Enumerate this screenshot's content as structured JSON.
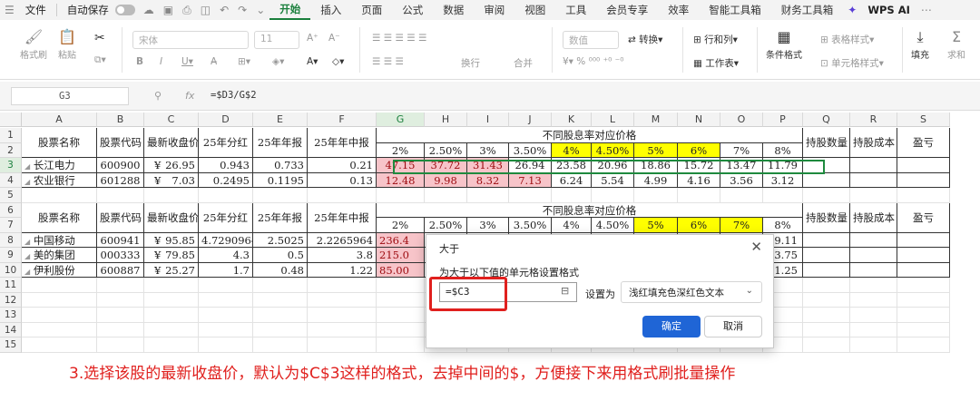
{
  "menubar": {
    "file": "文件",
    "autosave": "自动保存",
    "tabs": [
      "开始",
      "插入",
      "页面",
      "公式",
      "数据",
      "审阅",
      "视图",
      "工具",
      "会员专享",
      "效率",
      "智能工具箱",
      "财务工具箱"
    ],
    "ai": "WPS AI"
  },
  "ribbon": {
    "format_painter": "格式刷",
    "paste": "粘贴",
    "font": "宋体",
    "font_size": "11",
    "wrap": "换行",
    "merge": "合并",
    "number_format": "数值",
    "convert": "转换",
    "rows_cols": "行和列",
    "worksheet": "工作表",
    "conditional_format": "条件格式",
    "table_style": "表格样式",
    "cell_style": "单元格样式",
    "fill": "填充",
    "sum": "求和"
  },
  "formula_bar": {
    "name_box": "G3",
    "fx": "fx",
    "formula": "=$D3/G$2"
  },
  "columns": [
    "A",
    "B",
    "C",
    "D",
    "E",
    "F",
    "G",
    "H",
    "I",
    "J",
    "K",
    "L",
    "M",
    "N",
    "O",
    "P",
    "Q",
    "R",
    "S"
  ],
  "rows": [
    "1",
    "2",
    "3",
    "4",
    "5",
    "6",
    "7",
    "8",
    "9",
    "10",
    "11",
    "12",
    "13",
    "14",
    "15"
  ],
  "table1": {
    "headers": [
      "股票名称",
      "股票代码",
      "最新收盘价",
      "25年分红",
      "25年年报",
      "25年年中报"
    ],
    "group_title": "不同股息率对应价格",
    "rates": [
      "2%",
      "2.50%",
      "3%",
      "3.50%",
      "4%",
      "4.50%",
      "5%",
      "6%",
      "7%",
      "8%"
    ],
    "extra": [
      "持股数量",
      "持股成本",
      "盈亏"
    ],
    "rows": [
      {
        "name": "长江电力",
        "code": "600900",
        "currency": "¥",
        "price": "26.95",
        "div": "0.943",
        "annual": "0.733",
        "half": "0.21",
        "vals": [
          "47.15",
          "37.72",
          "31.43",
          "26.94",
          "23.58",
          "20.96",
          "18.86",
          "15.72",
          "13.47",
          "11.79"
        ]
      },
      {
        "name": "农业银行",
        "code": "601288",
        "currency": "¥",
        "price": "7.03",
        "div": "0.2495",
        "annual": "0.1195",
        "half": "0.13",
        "vals": [
          "12.48",
          "9.98",
          "8.32",
          "7.13",
          "6.24",
          "5.54",
          "4.99",
          "4.16",
          "3.56",
          "3.12"
        ]
      }
    ]
  },
  "table2": {
    "headers": [
      "股票名称",
      "股票代码",
      "最新收盘价",
      "25年分红",
      "25年年报",
      "25年年中报"
    ],
    "group_title": "不同股息率对应价格",
    "rates": [
      "2%",
      "2.50%",
      "3%",
      "3.50%",
      "4%",
      "4.50%",
      "5%",
      "6%",
      "7%",
      "8%"
    ],
    "extra": [
      "持股数量",
      "持股成本",
      "盈亏"
    ],
    "rows": [
      {
        "name": "中国移动",
        "code": "600941",
        "currency": "¥",
        "price": "95.85",
        "div": "4.7290964",
        "annual": "2.5025",
        "half": "2.2265964",
        "g": "236.4",
        "p": "59.11"
      },
      {
        "name": "美的集团",
        "code": "000333",
        "currency": "¥",
        "price": "79.85",
        "div": "4.3",
        "annual": "0.5",
        "half": "3.8",
        "g": "215.0",
        "p": "53.75"
      },
      {
        "name": "伊利股份",
        "code": "600887",
        "currency": "¥",
        "price": "25.27",
        "div": "1.7",
        "annual": "0.48",
        "half": "1.22",
        "g": "85.00",
        "p": "21.25"
      }
    ]
  },
  "dialog": {
    "title": "大于",
    "prompt": "为大于以下值的单元格设置格式",
    "value": "=$C3",
    "set_as": "设置为",
    "style": "浅红填充色深红色文本",
    "ok": "确定",
    "cancel": "取消"
  },
  "caption": "3.选择该股的最新收盘价，默认为$C$3这样的格式，去掉中间的$，方便接下来用格式刷批量操作",
  "colors": {
    "accent": "#1a7f3c",
    "highlight_fill": "#f7c4c9",
    "highlight_text": "#9c0a0f",
    "yellow": "#ffff00",
    "annotation": "#e0201e",
    "primary_button": "#1f65d6"
  }
}
